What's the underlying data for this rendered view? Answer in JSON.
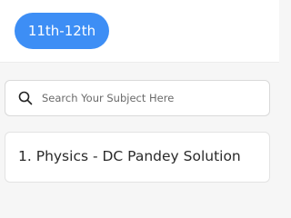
{
  "colors": {
    "accent": "#3d8ef5"
  },
  "header": {
    "class_pill_label": "11th-12th"
  },
  "search": {
    "icon": "search-icon",
    "placeholder": "Search Your Subject Here",
    "value": ""
  },
  "subjects": [
    {
      "label": "1. Physics - DC Pandey Solution"
    }
  ]
}
